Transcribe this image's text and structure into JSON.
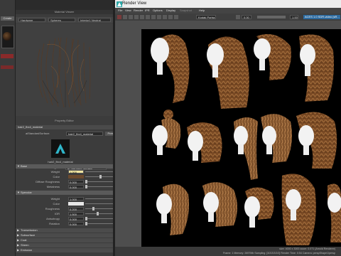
{
  "left_strip": {
    "tab_label": "Create"
  },
  "hypershade": {
    "panel_title": "Material Viewer",
    "toolbar": {
      "renderer": "Hardware",
      "geometry": "Spheres",
      "environment": "Interior1 Neutral"
    },
    "swatch_title": "Property Editor"
  },
  "attribute_editor": {
    "material_name": "hair2_fbx4_material",
    "shader_label": "aiStandardSurface:",
    "shader_value": "hair2_fbx4_material",
    "presets_label": "Presets*",
    "logo_name": "hair2_fbx4_material",
    "type_label": "Type",
    "type_value": "ai Standard Surface",
    "sections": [
      {
        "label": "Base",
        "open": true
      },
      {
        "label": "Specular",
        "open": true
      },
      {
        "label": "Transmission",
        "open": false
      },
      {
        "label": "Subsurface",
        "open": false
      },
      {
        "label": "Coat",
        "open": false
      },
      {
        "label": "Sheen",
        "open": false
      },
      {
        "label": "Emission",
        "open": false
      }
    ],
    "base_attrs": [
      {
        "label": "Weight",
        "value": "1.000",
        "fraction": 1.0
      },
      {
        "label": "Color",
        "value": "",
        "swatch": "#6b4a2e"
      },
      {
        "label": "Diffuse Roughness",
        "value": "0.000",
        "fraction": 0.0
      },
      {
        "label": "Metalness",
        "value": "0.000",
        "fraction": 0.0
      }
    ],
    "specular_attrs": [
      {
        "label": "Weight",
        "value": "1.000",
        "fraction": 1.0
      },
      {
        "label": "Color",
        "value": "",
        "swatch": "#e6e6e6"
      },
      {
        "label": "Roughness",
        "value": "0.200",
        "fraction": 0.2
      },
      {
        "label": "IOR",
        "value": "1.500",
        "fraction": 0.3
      },
      {
        "label": "Anisotropy",
        "value": "0.000",
        "fraction": 0.0
      },
      {
        "label": "Rotation",
        "value": "0.000",
        "fraction": 0.0
      }
    ]
  },
  "render_view": {
    "window_title": "Render View",
    "menu": [
      "File",
      "View",
      "Render",
      "IPR",
      "Options",
      "Display",
      "Snapshot",
      "Help"
    ],
    "toolbar": {
      "exposure": "0.00",
      "gamma": "1.00",
      "camera": "Kodak Portra",
      "frame_label": "RGB",
      "badge": "ACES 1.0 SDR-video (sR..."
    },
    "status": {
      "line1": "size: 4000 x 3000  zoom: 0.071        (Arnold Renderer)",
      "line2": "Frame: 1    Memory: 2697Mb    Sampling: [3/2/2/2/2/2]    Render Time: 0:54    Camera: perspShape1/persp"
    }
  },
  "colors": {
    "panel_bg": "#3c3c3c",
    "render_bg": "#000000",
    "hair_brown": "#8a5a30",
    "accent_blue": "#2d6ba0"
  }
}
